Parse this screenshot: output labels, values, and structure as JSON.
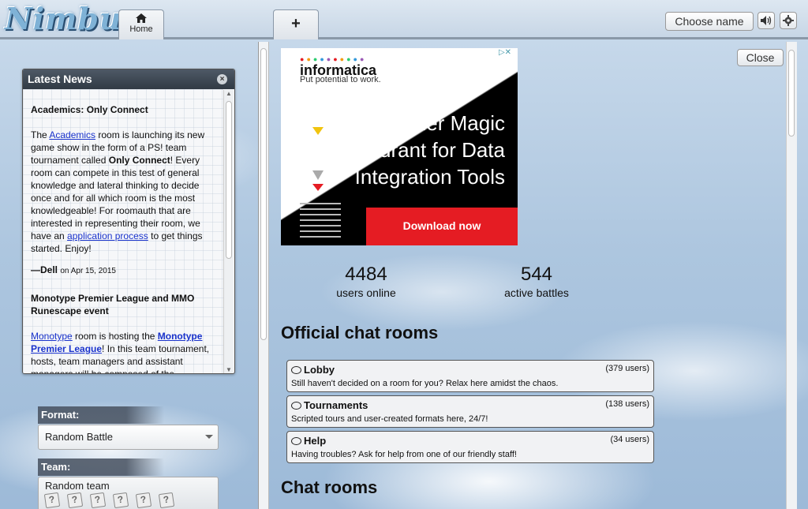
{
  "header": {
    "logo_text": "Nimbus",
    "tabs": [
      {
        "label": "Home"
      },
      {
        "label": "+"
      }
    ],
    "choose_name_label": "Choose name",
    "sound_icon": "speaker-icon",
    "settings_icon": "gear-icon"
  },
  "news": {
    "title": "Latest News",
    "close_glyph": "×",
    "article1": {
      "title": "Academics: Only Connect",
      "p_before_link": "The ",
      "link1": "Academics",
      "p_mid1": " room is launching its new game show in the form of a PS! team tournament called ",
      "bold1": "Only Connect",
      "p_mid2": "! Every room can compete in this test of general knowledge and lateral thinking to decide once and for all which room is the most knowledgeable! For roomauth that are interested in representing their room, we have an ",
      "link2": "application process",
      "p_end": " to get things started. Enjoy!",
      "author": "—Dell",
      "date": "on Apr 15, 2015"
    },
    "article2": {
      "title": "Monotype Premier League and MMO Runescape event",
      "link1": "Monotype",
      "p_mid1": " room is hosting the ",
      "link2": "Monotype Premier League",
      "p_end": "! In this team tournament, hosts, team managers and assistant managers will be composed of the"
    }
  },
  "battle_form": {
    "format_label": "Format:",
    "format_value": "Random Battle",
    "team_label": "Team:",
    "team_value": "Random team"
  },
  "main": {
    "close_label": "Close",
    "ad": {
      "brand": "informatica",
      "tagline": "Put potential to work.",
      "headline": "Gartner Magic Quadrant for Data Integration Tools",
      "cta": "Download now",
      "info": "▷✕"
    },
    "stats": {
      "users_online": "4484",
      "users_online_label": "users online",
      "active_battles": "544",
      "active_battles_label": "active battles"
    },
    "official_title": "Official chat rooms",
    "rooms": [
      {
        "name": "Lobby",
        "users": "(379 users)",
        "desc": "Still haven't decided on a room for you? Relax here amidst the chaos."
      },
      {
        "name": "Tournaments",
        "users": "(138 users)",
        "desc": "Scripted tours and user-created formats here, 24/7!"
      },
      {
        "name": "Help",
        "users": "(34 users)",
        "desc": "Having troubles? Ask for help from one of our friendly staff!"
      }
    ],
    "chat_rooms_title": "Chat rooms"
  },
  "colors": {
    "accent_red": "#e51c23",
    "link_blue": "#1a33cc",
    "panel_dark": "#313a44"
  }
}
